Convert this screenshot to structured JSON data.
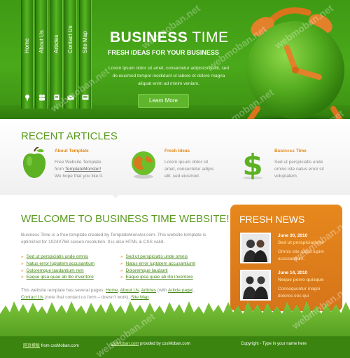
{
  "nav": {
    "items": [
      "Home",
      "About Us",
      "Articles",
      "Contact Us",
      "Site Map"
    ]
  },
  "header": {
    "title_bold": "BUSINESS",
    "title_light": "TIME",
    "subtitle": "FRESH IDEAS FOR YOUR BUSINESS",
    "description": "Lorem ipsum dolor sit amet, consectetur adipisicing elit, sed do eiusmod tempor incididunt ut labore et dolore magna aliquat enim ad minim veniam.",
    "learn_more": "Learn More"
  },
  "recent": {
    "title": "RECENT ARTICLES",
    "articles": [
      {
        "title": "About Template",
        "line1": "Free Website Template",
        "line2_pre": "from ",
        "line2_link": "TemplateMonster!",
        "line3": "We hope that you like it."
      },
      {
        "title": "Fresh Ideas",
        "line1": "Lorem ipsum dolor sit",
        "line2": "amet, consectetur adipis",
        "line3": "elit, sed eiusmod."
      },
      {
        "title": "Business Time",
        "line1": "Sed ut perspiciatis unde",
        "line2": "omnis iste natus error sit",
        "line3": "voluptatem."
      }
    ]
  },
  "welcome": {
    "title": "WELCOME TO BUSINESS TIME WEBSITE!",
    "text": "Business Time is a free template created by TemplateMonster.com. This website template is optimized for 1024X768 screen resolution. It is also HTML & CSS valid.",
    "list_left": [
      "Sed ut perspiciatis unde omnis",
      "Natus error luptatem accusantium",
      "Doloremque laudantium rem",
      "Eaque ipsa quae ab illo inventore"
    ],
    "list_right": [
      "Sed ut perspiciatis unde omnis",
      "Natus error luptatem accusantiumt",
      "Doloremque laudanti",
      "Eaque ipsa quae ab illo inventore"
    ],
    "pages_1": "This website template has several pages: ",
    "pages_home": "Home",
    "pages_sep1": ", ",
    "pages_about": "About Us",
    "pages_sep2": ", ",
    "pages_articles": "Articles",
    "pages_with": " (with ",
    "pages_article_page": "Article page",
    "pages_close": "),",
    "pages_contact": "Contact Us",
    "pages_note": " (note that contact us form – doesn't work), ",
    "pages_sitemap": "Site Map",
    "pages_end": "."
  },
  "news": {
    "title": "FRESH NEWS",
    "items": [
      {
        "date": "June 30, 2010",
        "headline": "Sed ut perspiciatiune",
        "line1": "Omnis iste natus lupim",
        "line2": "accusantium."
      },
      {
        "date": "June 14, 2010",
        "headline": "Neque porro quisque",
        "line1": "Consequuntur magni",
        "line2": "dolores eos qui"
      }
    ]
  },
  "footer": {
    "left_cn": "网页模板",
    "left_from": " from cssMoban.com",
    "mid_link": "cssMoban.com",
    "mid_text": " provded by cssMoban.com",
    "copyright": "Copyright - Type in your name here"
  },
  "watermark": "webmoban.net",
  "colors": {
    "brand_green": "#4aa91a",
    "heading_green": "#5a9a1e",
    "accent_orange": "#e28a1a",
    "news_orange": "#d6741a"
  }
}
